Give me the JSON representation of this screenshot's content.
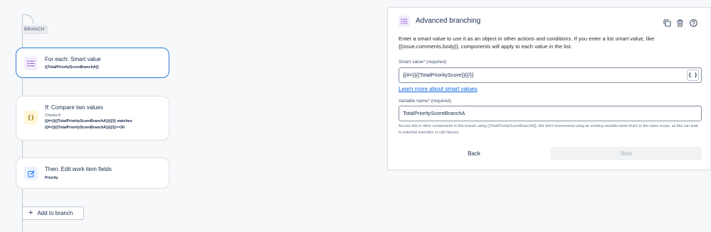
{
  "canvas": {
    "branch_badge": "BRANCH",
    "nodes": [
      {
        "title": "For each: Smart value",
        "subtitle": "{{TotalPriorityScoreBranchA}}",
        "icon": "list-icon",
        "selected": true
      },
      {
        "title": "If: Compare two values",
        "checks_label": "Checks if:",
        "line1": "{{#=}}{{TotalPriorityScoreBranchA}}{{/}} matches",
        "line2": "{{#=}}{{TotalPriorityScoreBranchA}}{{/}}>=30",
        "icon": "curly-braces-icon"
      },
      {
        "title": "Then: Edit work item fields",
        "subtitle": "Priority",
        "icon": "edit-icon"
      }
    ],
    "add_branch_label": "Add to branch"
  },
  "panel": {
    "title": "Advanced branching",
    "description": "Enter a smart value to use it as an object in other actions and conditions. If you enter a list smart value, like {{issue.comments.body}}, components will apply to each value in the list.",
    "smart_value_label": "Smart value",
    "smart_value_req": "* (required)",
    "smart_value": "{{#=}}{{TotalPriorityScore}}{{/}}",
    "brace_button": "{ }",
    "learn_more": "Learn more about smart values",
    "variable_label": "Variable name",
    "variable_req": "* (required)",
    "variable_value": "TotalPriorityScoreBranchA",
    "helper": "Access this in other components in this branch using {{TotalPriorityScoreBranchA}}. We don't recommend using an existing variable name that's in the same scope, as this can lead to potential overrides or rule failures.",
    "back_label": "Back",
    "next_label": "Next"
  },
  "colors": {
    "accent": "#2a7bd5",
    "link": "#0c66e4",
    "icon_purple_bg": "#f3ecfc",
    "icon_yellow_bg": "#fff7d6",
    "icon_blue_bg": "#e9f2ff"
  }
}
